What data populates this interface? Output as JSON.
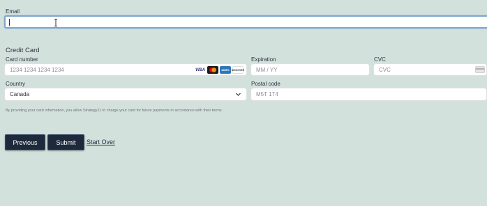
{
  "email": {
    "label": "Email",
    "value": ""
  },
  "credit_card": {
    "section_title": "Credit Card",
    "card_number": {
      "label": "Card number",
      "placeholder": "1234 1234 1234 1234",
      "brands": [
        "VISA",
        "mastercard",
        "AMEX",
        "DISCOVER"
      ]
    },
    "expiration": {
      "label": "Expiration",
      "placeholder": "MM / YY"
    },
    "cvc": {
      "label": "CVC",
      "placeholder": "CVC"
    },
    "country": {
      "label": "Country",
      "value": "Canada"
    },
    "postal_code": {
      "label": "Postal code",
      "placeholder": "M5T 1T4"
    },
    "disclaimer": "By providing your card information, you allow Strategy11 to charge your card for future payments in accordance with their terms."
  },
  "actions": {
    "previous_label": "Previous",
    "submit_label": "Submit",
    "start_over_label": "Start Over"
  },
  "colors": {
    "background": "#d3e1dd",
    "button": "#1e2a3c",
    "focus_border": "#7fa7c9"
  }
}
